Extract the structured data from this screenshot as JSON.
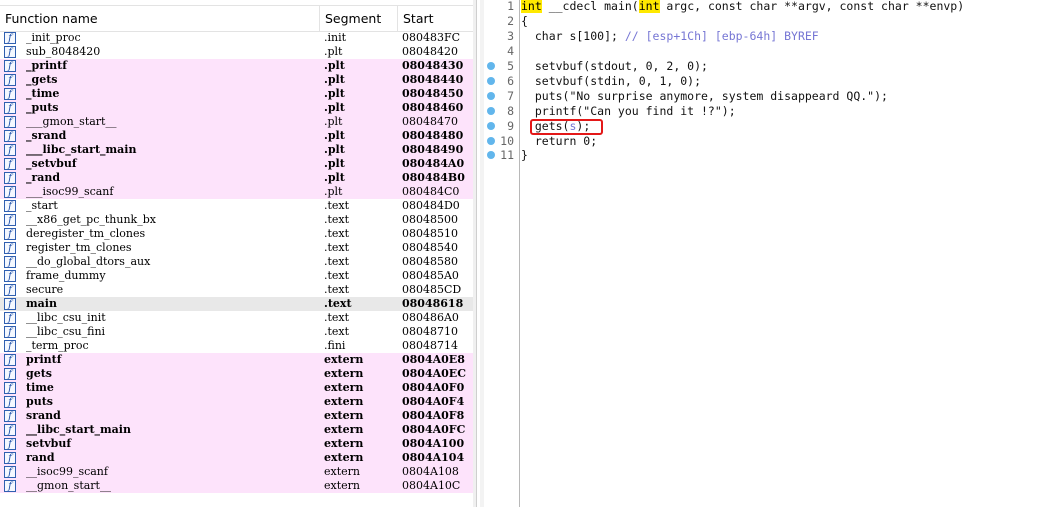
{
  "functions_window": {
    "columns": [
      "Function name",
      "Segment",
      "Start"
    ],
    "rows": [
      {
        "name": "_init_proc",
        "segment": ".init",
        "start": "080483FC",
        "style": "normal"
      },
      {
        "name": "sub_8048420",
        "segment": ".plt",
        "start": "08048420",
        "style": "normal"
      },
      {
        "name": "_printf",
        "segment": ".plt",
        "start": "08048430",
        "style": "pink-bold"
      },
      {
        "name": "_gets",
        "segment": ".plt",
        "start": "08048440",
        "style": "pink-bold"
      },
      {
        "name": "_time",
        "segment": ".plt",
        "start": "08048450",
        "style": "pink-bold"
      },
      {
        "name": "_puts",
        "segment": ".plt",
        "start": "08048460",
        "style": "pink-bold"
      },
      {
        "name": "___gmon_start__",
        "segment": ".plt",
        "start": "08048470",
        "style": "pink"
      },
      {
        "name": "_srand",
        "segment": ".plt",
        "start": "08048480",
        "style": "pink-bold"
      },
      {
        "name": "___libc_start_main",
        "segment": ".plt",
        "start": "08048490",
        "style": "pink-bold"
      },
      {
        "name": "_setvbuf",
        "segment": ".plt",
        "start": "080484A0",
        "style": "pink-bold"
      },
      {
        "name": "_rand",
        "segment": ".plt",
        "start": "080484B0",
        "style": "pink-bold"
      },
      {
        "name": "___isoc99_scanf",
        "segment": ".plt",
        "start": "080484C0",
        "style": "pink"
      },
      {
        "name": "_start",
        "segment": ".text",
        "start": "080484D0",
        "style": "normal"
      },
      {
        "name": "__x86_get_pc_thunk_bx",
        "segment": ".text",
        "start": "08048500",
        "style": "normal"
      },
      {
        "name": "deregister_tm_clones",
        "segment": ".text",
        "start": "08048510",
        "style": "normal"
      },
      {
        "name": "register_tm_clones",
        "segment": ".text",
        "start": "08048540",
        "style": "normal"
      },
      {
        "name": "__do_global_dtors_aux",
        "segment": ".text",
        "start": "08048580",
        "style": "normal"
      },
      {
        "name": "frame_dummy",
        "segment": ".text",
        "start": "080485A0",
        "style": "normal"
      },
      {
        "name": "secure",
        "segment": ".text",
        "start": "080485CD",
        "style": "normal"
      },
      {
        "name": "main",
        "segment": ".text",
        "start": "08048618",
        "style": "selected-bold"
      },
      {
        "name": "__libc_csu_init",
        "segment": ".text",
        "start": "080486A0",
        "style": "normal"
      },
      {
        "name": "__libc_csu_fini",
        "segment": ".text",
        "start": "08048710",
        "style": "normal"
      },
      {
        "name": "_term_proc",
        "segment": ".fini",
        "start": "08048714",
        "style": "normal"
      },
      {
        "name": "printf",
        "segment": "extern",
        "start": "0804A0E8",
        "style": "pink-bold"
      },
      {
        "name": "gets",
        "segment": "extern",
        "start": "0804A0EC",
        "style": "pink-bold"
      },
      {
        "name": "time",
        "segment": "extern",
        "start": "0804A0F0",
        "style": "pink-bold"
      },
      {
        "name": "puts",
        "segment": "extern",
        "start": "0804A0F4",
        "style": "pink-bold"
      },
      {
        "name": "srand",
        "segment": "extern",
        "start": "0804A0F8",
        "style": "pink-bold"
      },
      {
        "name": "__libc_start_main",
        "segment": "extern",
        "start": "0804A0FC",
        "style": "pink-bold"
      },
      {
        "name": "setvbuf",
        "segment": "extern",
        "start": "0804A100",
        "style": "pink-bold"
      },
      {
        "name": "rand",
        "segment": "extern",
        "start": "0804A104",
        "style": "pink-bold"
      },
      {
        "name": "__isoc99_scanf",
        "segment": "extern",
        "start": "0804A108",
        "style": "pink"
      },
      {
        "name": "__gmon_start__",
        "segment": "extern",
        "start": "0804A10C",
        "style": "pink"
      }
    ]
  },
  "pseudocode": {
    "lines": [
      {
        "num": "1",
        "bp": false,
        "parts": [
          [
            "kw",
            "int"
          ],
          [
            "t",
            " __cdecl main("
          ],
          [
            "kw",
            "int"
          ],
          [
            "t",
            " argc, const char **argv, const char **envp)"
          ]
        ]
      },
      {
        "num": "2",
        "bp": false,
        "parts": [
          [
            "t",
            "{"
          ]
        ]
      },
      {
        "num": "3",
        "bp": false,
        "parts": [
          [
            "t",
            "  char s[100]; "
          ],
          [
            "cm",
            "// [esp+1Ch] [ebp-64h] BYREF"
          ]
        ]
      },
      {
        "num": "4",
        "bp": false,
        "parts": [
          [
            "t",
            ""
          ]
        ]
      },
      {
        "num": "5",
        "bp": true,
        "parts": [
          [
            "t",
            "  setvbuf(stdout, 0, 2, 0);"
          ]
        ]
      },
      {
        "num": "6",
        "bp": true,
        "parts": [
          [
            "t",
            "  setvbuf(stdin, 0, 1, 0);"
          ]
        ]
      },
      {
        "num": "7",
        "bp": true,
        "parts": [
          [
            "t",
            "  puts(\"No surprise anymore, system disappeard QQ.\");"
          ]
        ]
      },
      {
        "num": "8",
        "bp": true,
        "parts": [
          [
            "t",
            "  printf(\"Can you find it !?\");"
          ]
        ]
      },
      {
        "num": "9",
        "bp": true,
        "parts": [
          [
            "t",
            "  gets("
          ],
          [
            "cm",
            "s"
          ],
          [
            "t",
            ");"
          ]
        ]
      },
      {
        "num": "10",
        "bp": true,
        "parts": [
          [
            "t",
            "  return 0;"
          ]
        ]
      },
      {
        "num": "11",
        "bp": true,
        "parts": [
          [
            "t",
            "}"
          ]
        ]
      }
    ],
    "colors": {
      "keyword_bg": "#ffe900",
      "comment": "#7676d4",
      "breakpoint": "#62b6ec",
      "highlight_box": "#e31818"
    }
  }
}
